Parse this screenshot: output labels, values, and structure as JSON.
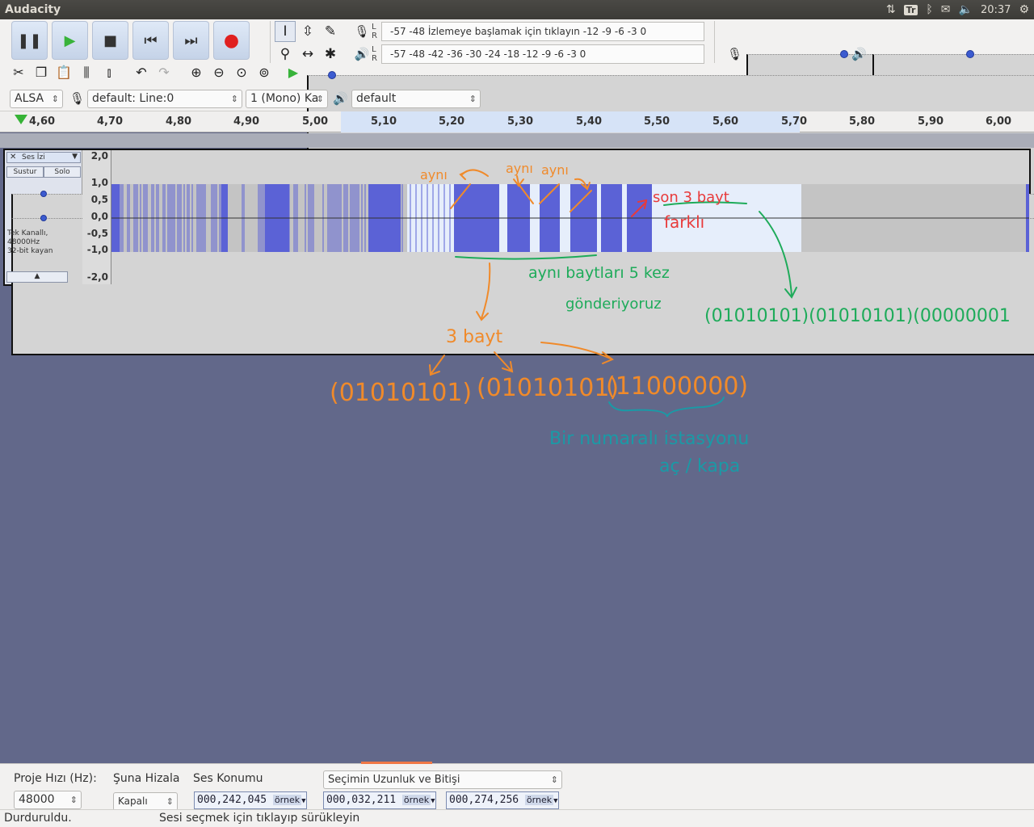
{
  "window": {
    "title": "Audacity"
  },
  "panel": {
    "keyboard": "Tr",
    "clock": "20:37"
  },
  "transport": {
    "pause": "❚❚",
    "play": "▶",
    "stop": "■",
    "skip_start": "⏮",
    "skip_end": "⏭",
    "record": "●"
  },
  "meters": {
    "record_scale": "-57      -48 İzlemeye başlamak için tıklayın -12 -9 -6 -3 0",
    "play_scale": "-57      -48      -42      -36      -30      -24      -18      -12 -9 -6 -3 0",
    "l": "L",
    "r": "R"
  },
  "devices": {
    "host": "ALSA",
    "input": "default: Line:0",
    "channels": "1 (Mono) Ka",
    "output": "default"
  },
  "ruler": {
    "ticks": [
      "4,60",
      "4,70",
      "4,80",
      "4,90",
      "5,00",
      "5,10",
      "5,20",
      "5,30",
      "5,40",
      "5,50",
      "5,60",
      "5,70",
      "5,80",
      "5,90",
      "6,00"
    ]
  },
  "track": {
    "name": "Ses İzi",
    "mute": "Sustur",
    "solo": "Solo",
    "info_line1": "Tek Kanallı, 48000Hz",
    "info_line2": "32-bit kayan",
    "scale": [
      "2,0",
      "1,0",
      "0,5",
      "0,0",
      "-0,5",
      "-1,0",
      "-2,0"
    ]
  },
  "annotations": {
    "same": "aynı",
    "last3": "son 3 bayt",
    "different": "farklı",
    "same5": "aynı baytları 5 kez",
    "sent": "gönderiyoruz",
    "bits_right": "(01010101)(01010101)(00000001",
    "three_bytes": "3 bayt",
    "b1": "(01010101)",
    "b2": "(01010101)",
    "b3": "(11000000)",
    "station": "Bir numaralı istasyonu",
    "onoff": "aç / kapa"
  },
  "bottom": {
    "rate_label": "Proje Hızı (Hz):",
    "rate_value": "48000",
    "snap_label": "Şuna Hizala",
    "snap_value": "Kapalı",
    "pos_label": "Ses Konumu",
    "sel_label": "Seçimin Uzunluk ve Bitişi",
    "pos_value": "000,242,045",
    "len_value": "000,032,211",
    "end_value": "000,274,256",
    "unit": "örnek"
  },
  "status": {
    "left": "Durduruldu.",
    "right": "Sesi seçmek için tıklayıp sürükleyin"
  }
}
